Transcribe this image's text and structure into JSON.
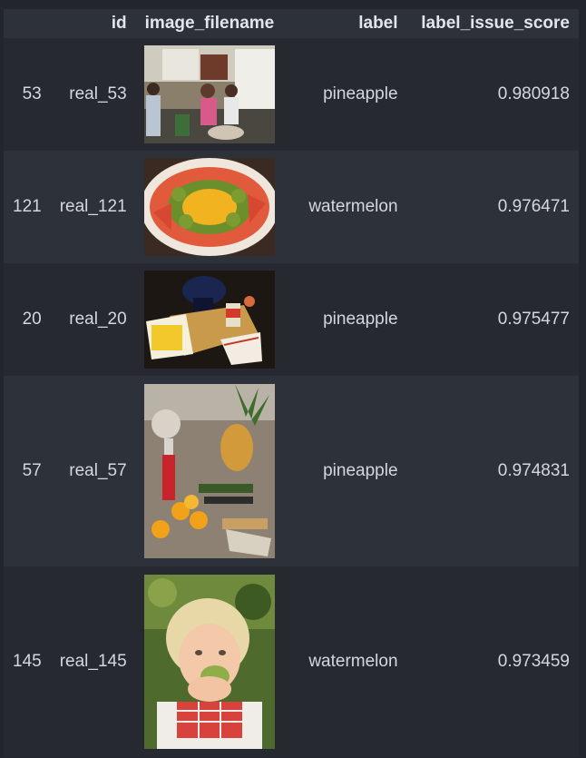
{
  "table": {
    "headers": [
      "",
      "id",
      "image_filename",
      "label",
      "label_issue_score"
    ],
    "rows": [
      {
        "index": "53",
        "id": "real_53",
        "image": "kitchen-people-photo",
        "label": "pineapple",
        "score": "0.980918"
      },
      {
        "index": "121",
        "id": "real_121",
        "image": "fruit-platter-photo",
        "label": "watermelon",
        "score": "0.976471"
      },
      {
        "index": "20",
        "id": "real_20",
        "image": "fondue-table-photo",
        "label": "pineapple",
        "score": "0.975477"
      },
      {
        "index": "57",
        "id": "real_57",
        "image": "market-table-pineapple-photo",
        "label": "pineapple",
        "score": "0.974831"
      },
      {
        "index": "145",
        "id": "real_145",
        "image": "child-eating-photo",
        "label": "watermelon",
        "score": "0.973459"
      }
    ]
  }
}
